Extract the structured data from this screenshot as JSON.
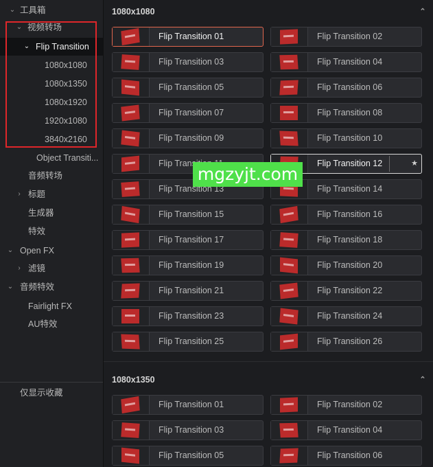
{
  "sidebar": {
    "items": [
      {
        "label": "工具箱",
        "chevron": "⌄",
        "selected": false
      },
      {
        "label": "视频转场",
        "chevron": "⌄",
        "selected": false
      },
      {
        "label": "Flip Transition",
        "chevron": "⌄",
        "selected": true
      },
      {
        "label": "1080x1080",
        "chevron": "",
        "selected": false
      },
      {
        "label": "1080x1350",
        "chevron": "",
        "selected": false
      },
      {
        "label": "1080x1920",
        "chevron": "",
        "selected": false
      },
      {
        "label": "1920x1080",
        "chevron": "",
        "selected": false
      },
      {
        "label": "3840x2160",
        "chevron": "",
        "selected": false
      },
      {
        "label": "Object Transiti...",
        "chevron": "",
        "selected": false
      },
      {
        "label": "音频转场",
        "chevron": "",
        "selected": false
      },
      {
        "label": "标题",
        "chevron": "›",
        "selected": false
      },
      {
        "label": "生成器",
        "chevron": "",
        "selected": false
      },
      {
        "label": "特效",
        "chevron": "",
        "selected": false
      },
      {
        "label": "Open FX",
        "chevron": "⌄",
        "selected": false
      },
      {
        "label": "滤镜",
        "chevron": "›",
        "selected": false
      },
      {
        "label": "音频特效",
        "chevron": "⌄",
        "selected": false
      },
      {
        "label": "Fairlight FX",
        "chevron": "",
        "selected": false
      },
      {
        "label": "AU特效",
        "chevron": "",
        "selected": false
      }
    ],
    "favorites_only": "仅显示收藏"
  },
  "sections": [
    {
      "title": "1080x1080",
      "collapse_icon": "⌃",
      "tiles": [
        "Flip Transition 01",
        "Flip Transition 02",
        "Flip Transition 03",
        "Flip Transition 04",
        "Flip Transition 05",
        "Flip Transition 06",
        "Flip Transition 07",
        "Flip Transition 08",
        "Flip Transition 09",
        "Flip Transition 10",
        "Flip Transition 11",
        "Flip Transition 12",
        "Flip Transition 13",
        "Flip Transition 14",
        "Flip Transition 15",
        "Flip Transition 16",
        "Flip Transition 17",
        "Flip Transition 18",
        "Flip Transition 19",
        "Flip Transition 20",
        "Flip Transition 21",
        "Flip Transition 22",
        "Flip Transition 23",
        "Flip Transition 24",
        "Flip Transition 25",
        "Flip Transition 26"
      ]
    },
    {
      "title": "1080x1350",
      "collapse_icon": "⌃",
      "tiles": [
        "Flip Transition 01",
        "Flip Transition 02",
        "Flip Transition 03",
        "Flip Transition 04",
        "Flip Transition 05",
        "Flip Transition 06"
      ]
    }
  ],
  "favorite_star": "★",
  "watermark": "mgzyjt.com",
  "colors": {
    "highlight_box": "#e0262a",
    "active_border": "#e2674e",
    "thumb_red": "#bb2b2b",
    "watermark_bg": "#4fe04a"
  }
}
